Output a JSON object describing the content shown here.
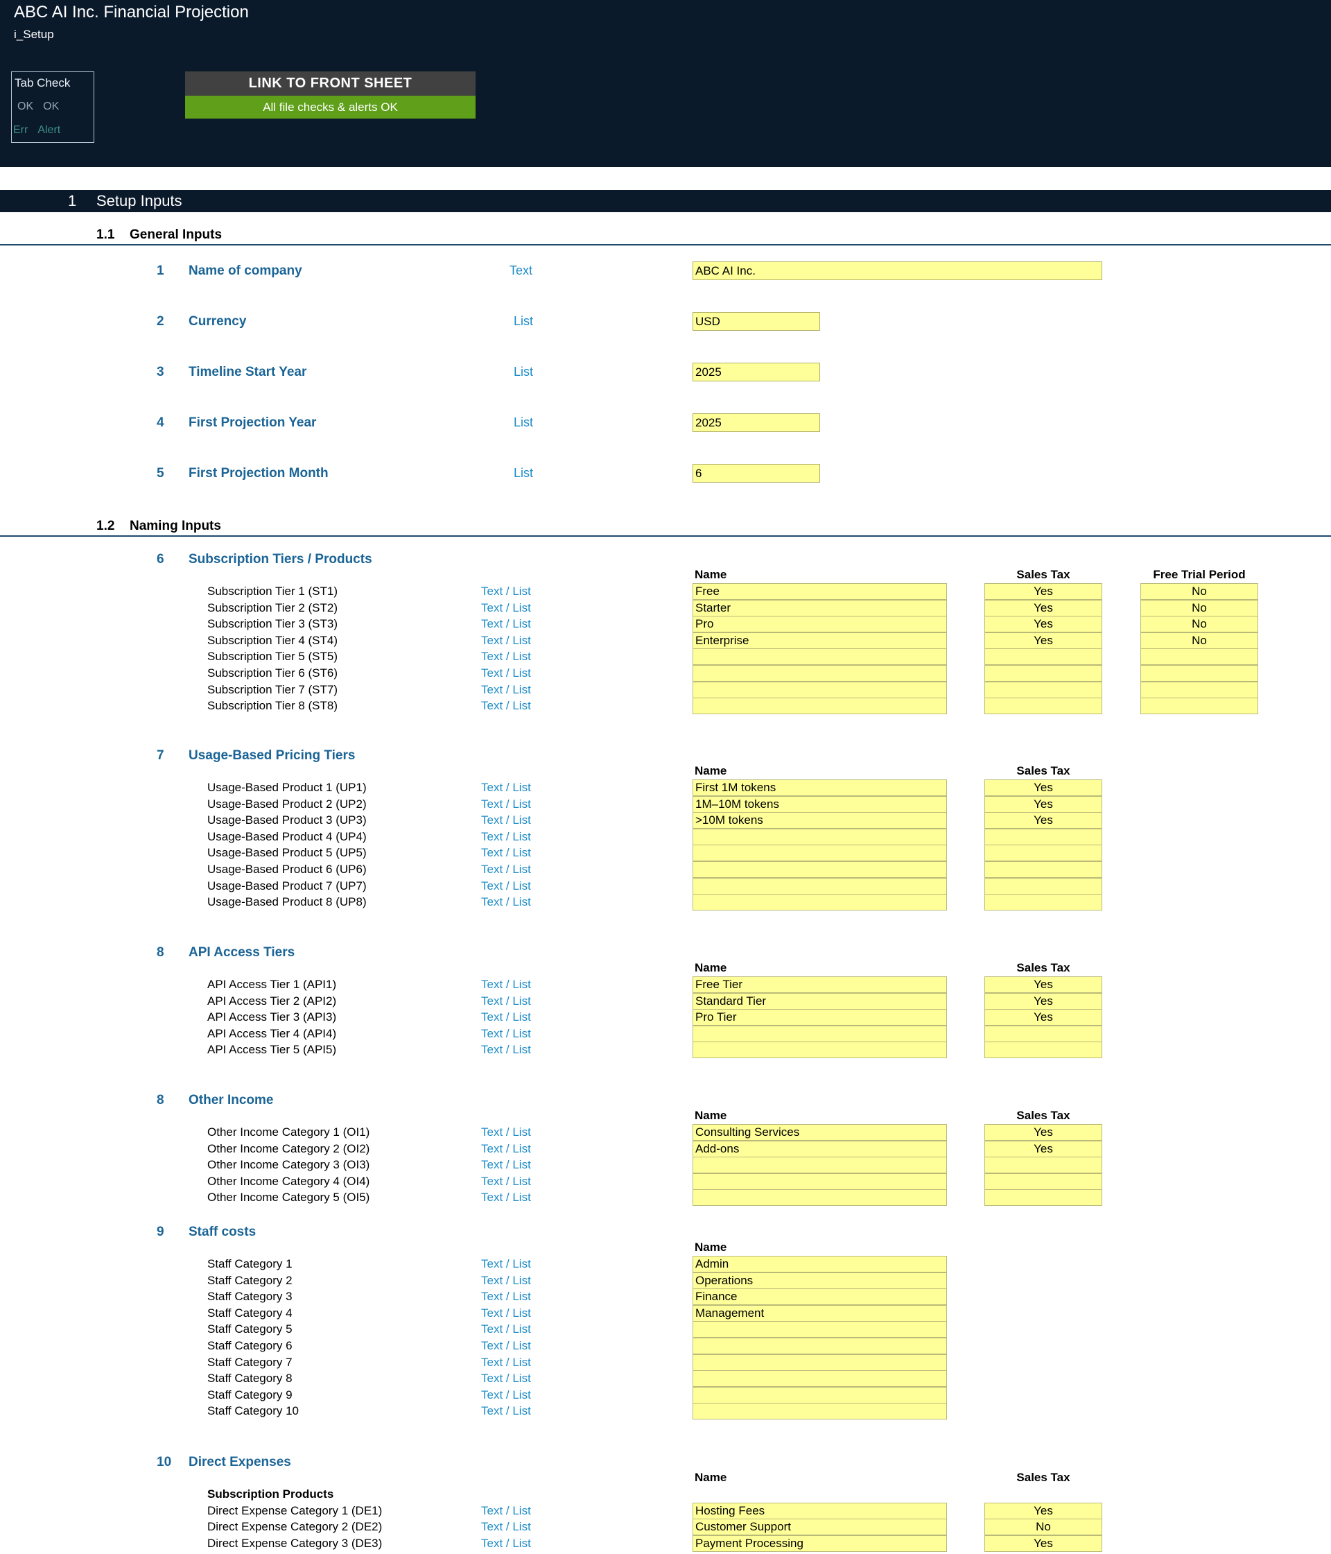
{
  "header": {
    "title": "ABC AI Inc. Financial Projection",
    "sheet": "i_Setup",
    "tab_check": {
      "title": "Tab Check",
      "ok_left": "OK",
      "ok_right": "OK",
      "err_left": "Err",
      "err_right": "Alert"
    },
    "front_link": "LINK TO FRONT SHEET",
    "checks_status": "All file checks & alerts OK"
  },
  "section": {
    "num": "1",
    "label": "Setup Inputs"
  },
  "general": {
    "num": "1.1",
    "label": "General Inputs",
    "rows": [
      {
        "num": "1",
        "label": "Name of company",
        "type": "Text",
        "value": "ABC AI Inc."
      },
      {
        "num": "2",
        "label": "Currency",
        "type": "List",
        "value": "USD"
      },
      {
        "num": "3",
        "label": "Timeline Start Year",
        "type": "List",
        "value": "2025"
      },
      {
        "num": "4",
        "label": "First Projection Year",
        "type": "List",
        "value": "2025"
      },
      {
        "num": "5",
        "label": "First Projection Month",
        "type": "List",
        "value": "6"
      }
    ]
  },
  "naming": {
    "num": "1.2",
    "label": "Naming Inputs",
    "col_name": "Name",
    "col_tax": "Sales Tax",
    "col_trial": "Free Trial Period",
    "type_label": "Text / List",
    "groups": [
      {
        "num": "6",
        "title": "Subscription Tiers / Products",
        "rows": [
          {
            "label": "Subscription Tier 1 (ST1)",
            "name": "Free",
            "tax": "Yes",
            "trial": "No"
          },
          {
            "label": "Subscription Tier 2 (ST2)",
            "name": "Starter",
            "tax": "Yes",
            "trial": "No"
          },
          {
            "label": "Subscription Tier 3 (ST3)",
            "name": "Pro",
            "tax": "Yes",
            "trial": "No"
          },
          {
            "label": "Subscription Tier 4 (ST4)",
            "name": "Enterprise",
            "tax": "Yes",
            "trial": "No"
          },
          {
            "label": "Subscription Tier 5 (ST5)",
            "name": "",
            "tax": "",
            "trial": ""
          },
          {
            "label": "Subscription Tier 6 (ST6)",
            "name": "",
            "tax": "",
            "trial": ""
          },
          {
            "label": "Subscription Tier 7 (ST7)",
            "name": "",
            "tax": "",
            "trial": ""
          },
          {
            "label": "Subscription Tier 8 (ST8)",
            "name": "",
            "tax": "",
            "trial": ""
          }
        ]
      },
      {
        "num": "7",
        "title": "Usage-Based Pricing Tiers",
        "rows": [
          {
            "label": "Usage-Based Product 1 (UP1)",
            "name": "First 1M tokens",
            "tax": "Yes"
          },
          {
            "label": "Usage-Based Product 2 (UP2)",
            "name": "1M–10M tokens",
            "tax": "Yes"
          },
          {
            "label": "Usage-Based Product 3 (UP3)",
            "name": ">10M tokens",
            "tax": "Yes"
          },
          {
            "label": "Usage-Based Product 4 (UP4)",
            "name": "",
            "tax": ""
          },
          {
            "label": "Usage-Based Product 5 (UP5)",
            "name": "",
            "tax": ""
          },
          {
            "label": "Usage-Based Product 6 (UP6)",
            "name": "",
            "tax": ""
          },
          {
            "label": "Usage-Based Product 7 (UP7)",
            "name": "",
            "tax": ""
          },
          {
            "label": "Usage-Based Product 8 (UP8)",
            "name": "",
            "tax": ""
          }
        ]
      },
      {
        "num": "8",
        "title": "API Access Tiers",
        "rows": [
          {
            "label": "API Access Tier 1 (API1)",
            "name": "Free Tier",
            "tax": "Yes"
          },
          {
            "label": "API Access Tier 2 (API2)",
            "name": "Standard Tier",
            "tax": "Yes"
          },
          {
            "label": "API Access Tier 3 (API3)",
            "name": "Pro Tier",
            "tax": "Yes"
          },
          {
            "label": "API Access Tier 4 (API4)",
            "name": "",
            "tax": ""
          },
          {
            "label": "API Access Tier 5 (API5)",
            "name": "",
            "tax": ""
          }
        ]
      },
      {
        "num": "8",
        "title": "Other Income",
        "rows": [
          {
            "label": "Other Income Category 1 (OI1)",
            "name": "Consulting Services",
            "tax": "Yes"
          },
          {
            "label": "Other Income Category 2 (OI2)",
            "name": "Add-ons",
            "tax": "Yes"
          },
          {
            "label": "Other Income Category 3 (OI3)",
            "name": "",
            "tax": ""
          },
          {
            "label": "Other Income Category 4 (OI4)",
            "name": "",
            "tax": ""
          },
          {
            "label": "Other Income Category 5 (OI5)",
            "name": "",
            "tax": ""
          }
        ]
      },
      {
        "num": "9",
        "title": "Staff costs",
        "rows": [
          {
            "label": "Staff Category 1",
            "name": "Admin"
          },
          {
            "label": "Staff Category 2",
            "name": "Operations"
          },
          {
            "label": "Staff Category 3",
            "name": "Finance"
          },
          {
            "label": "Staff Category 4",
            "name": "Management"
          },
          {
            "label": "Staff Category 5",
            "name": ""
          },
          {
            "label": "Staff Category 6",
            "name": ""
          },
          {
            "label": "Staff Category 7",
            "name": ""
          },
          {
            "label": "Staff Category 8",
            "name": ""
          },
          {
            "label": "Staff Category 9",
            "name": ""
          },
          {
            "label": "Staff Category 10",
            "name": ""
          }
        ]
      },
      {
        "num": "10",
        "title": "Direct Expenses",
        "subheader": "Subscription Products",
        "rows": [
          {
            "label": "Direct Expense Category 1 (DE1)",
            "name": "Hosting Fees",
            "tax": "Yes"
          },
          {
            "label": "Direct Expense Category 2 (DE2)",
            "name": "Customer Support",
            "tax": "No"
          },
          {
            "label": "Direct Expense Category 3 (DE3)",
            "name": "Payment Processing",
            "tax": "Yes"
          }
        ]
      }
    ]
  },
  "colors": {
    "header_bg": "#0b1a2b",
    "link_bg": "#414141",
    "ok_bg": "#5f9f1a",
    "input_fill": "#ffff99",
    "label_blue": "#1a6496",
    "type_blue": "#1e8cc8"
  }
}
